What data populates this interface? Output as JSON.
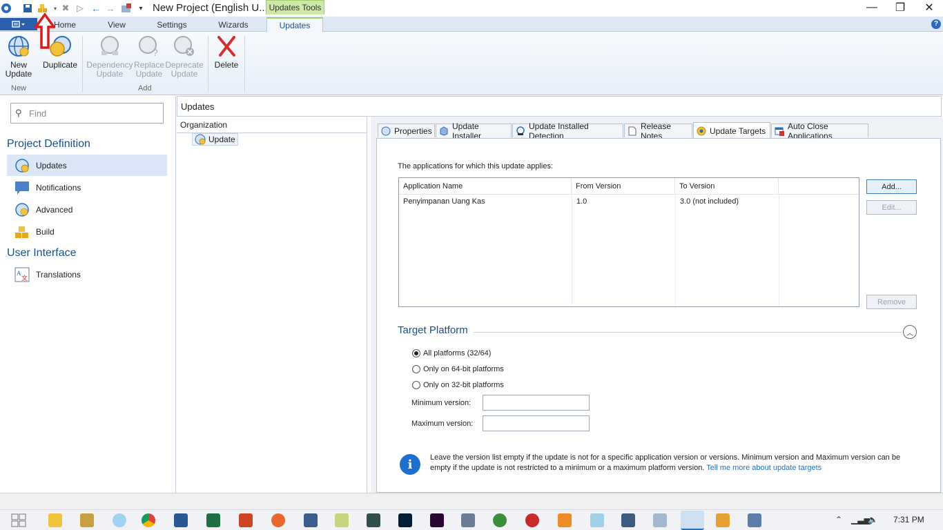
{
  "window": {
    "title": "New Project (English U...",
    "context_tab_title": "Updates Tools",
    "minimize": "—",
    "maximize": "❐",
    "close": "✕"
  },
  "ribbon_tabs": [
    {
      "label": "Home"
    },
    {
      "label": "View"
    },
    {
      "label": "Settings"
    },
    {
      "label": "Wizards"
    },
    {
      "label": "Updates"
    }
  ],
  "help_label": "?",
  "ribbon": {
    "new_update": "New Update",
    "duplicate": "Duplicate",
    "group_new": "New",
    "dependency_update": "Dependency Update",
    "replace_update": "Replace Update",
    "deprecate_update": "Deprecate Update",
    "group_add": "Add",
    "delete": "Delete"
  },
  "left_pane": {
    "find_placeholder": "Find",
    "section_project": "Project Definition",
    "items_project": [
      "Updates",
      "Notifications",
      "Advanced",
      "Build"
    ],
    "section_ui": "User Interface",
    "items_ui": [
      "Translations"
    ]
  },
  "middle": {
    "header": "Updates",
    "tree_header": "Organization",
    "tree_node": "Update"
  },
  "detail_tabs": [
    "Properties",
    "Update Installer",
    "Update Installed Detection",
    "Release Notes",
    "Update Targets",
    "Auto Close Applications"
  ],
  "targets": {
    "intro": "The applications for which this update applies:",
    "columns": [
      "Application Name",
      "From Version",
      "To Version"
    ],
    "rows": [
      {
        "name": "Penyimpanan Uang Kas",
        "from": "1.0",
        "to": "3.0 (not included)"
      }
    ],
    "add": "Add...",
    "edit": "Edit...",
    "remove": "Remove"
  },
  "platform": {
    "title": "Target Platform",
    "options": [
      "All platforms (32/64)",
      "Only on 64-bit platforms",
      "Only on 32-bit platforms"
    ],
    "selected_index": 0,
    "min_label": "Minimum version:",
    "max_label": "Maximum version:",
    "min_value": "",
    "max_value": ""
  },
  "info": {
    "text": "Leave the version list empty if the update is not for a specific application version or versions. Minimum version and Maximum version can be empty if the update is not restricted to a minimum or a maximum platform version.",
    "link": "Tell me more about update targets"
  },
  "taskbar": {
    "clock": "7:31 PM"
  },
  "colors": {
    "accent": "#1a4f93",
    "context_tab": "#cde8a8",
    "annotation_arrow": "#e01818"
  }
}
